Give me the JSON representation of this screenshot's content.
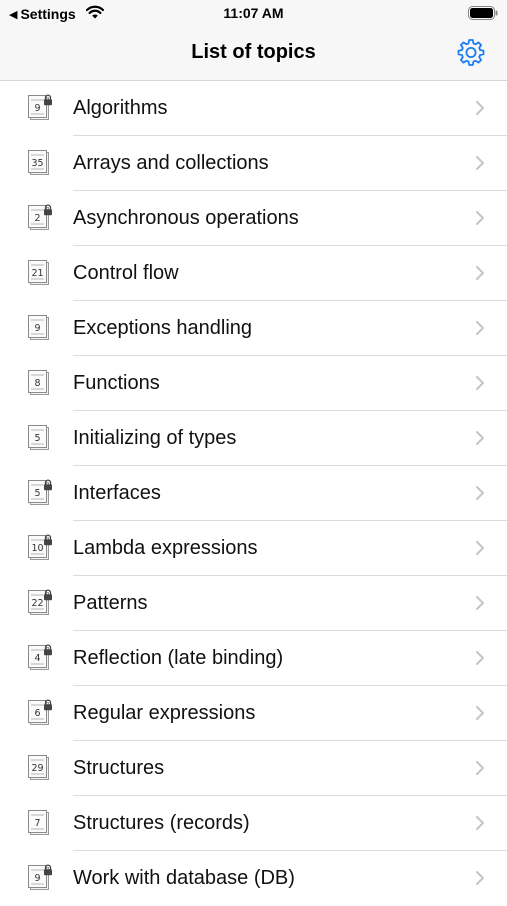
{
  "status_bar": {
    "back_arrow": "◀",
    "back_label": "Settings",
    "time": "11:07 AM"
  },
  "nav": {
    "title": "List of topics",
    "settings_icon": "gear-icon",
    "accent_color": "#1a7cf5"
  },
  "topics": [
    {
      "label": "Algorithms",
      "count": "9",
      "locked": true
    },
    {
      "label": "Arrays and collections",
      "count": "35",
      "locked": false
    },
    {
      "label": "Asynchronous operations",
      "count": "2",
      "locked": true
    },
    {
      "label": "Control flow",
      "count": "21",
      "locked": false
    },
    {
      "label": "Exceptions handling",
      "count": "9",
      "locked": false
    },
    {
      "label": "Functions",
      "count": "8",
      "locked": false
    },
    {
      "label": "Initializing of types",
      "count": "5",
      "locked": false
    },
    {
      "label": "Interfaces",
      "count": "5",
      "locked": true
    },
    {
      "label": "Lambda expressions",
      "count": "10",
      "locked": true
    },
    {
      "label": "Patterns",
      "count": "22",
      "locked": true
    },
    {
      "label": "Reflection (late binding)",
      "count": "4",
      "locked": true
    },
    {
      "label": "Regular expressions",
      "count": "6",
      "locked": true
    },
    {
      "label": "Structures",
      "count": "29",
      "locked": false
    },
    {
      "label": "Structures (records)",
      "count": "7",
      "locked": false
    },
    {
      "label": "Work with database (DB)",
      "count": "9",
      "locked": true
    }
  ]
}
